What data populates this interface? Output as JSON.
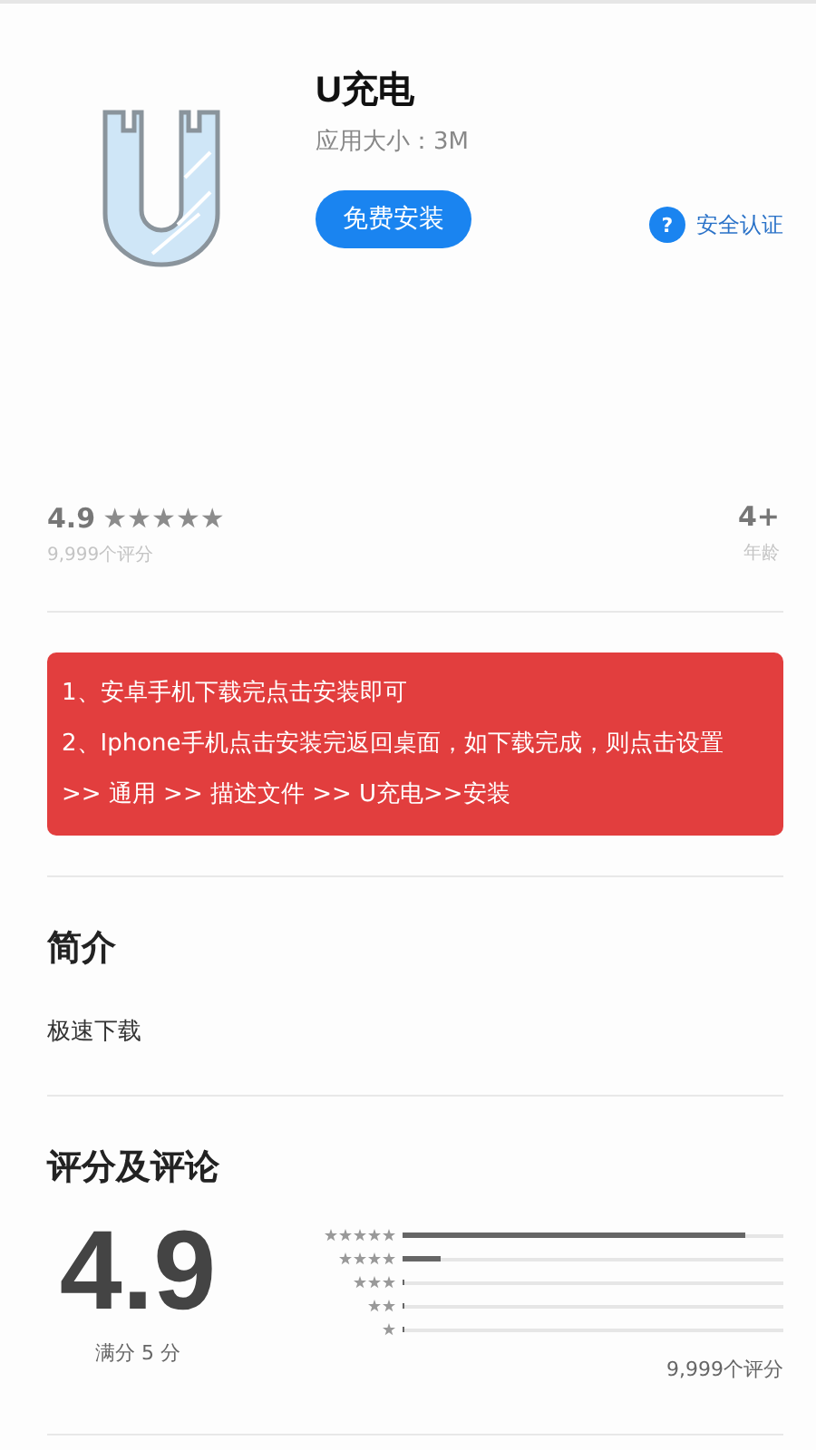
{
  "app": {
    "name": "U充电",
    "size": "应用大小：3M",
    "install_button": "免费安装",
    "security_label": "安全认证",
    "security_icon_text": "?"
  },
  "rating_summary": {
    "score": "4.9",
    "stars": 5,
    "count": "9,999个评分",
    "age": "4+",
    "age_label": "年龄"
  },
  "notice": {
    "lines": [
      "1、安卓手机下载完点击安装即可",
      "2、Iphone手机点击安装完返回桌面，如下载完成，则点击设置 >> 通用 >> 描述文件 >> U充电>>安装"
    ]
  },
  "intro": {
    "heading": "简介",
    "text": "极速下载"
  },
  "reviews": {
    "heading": "评分及评论",
    "score": "4.9",
    "out_of": "满分 5 分",
    "count": "9,999个评分",
    "histogram": [
      {
        "level": 0.9
      },
      {
        "level": 0.1
      },
      {
        "level": 0
      },
      {
        "level": 0
      },
      {
        "level": 0
      }
    ]
  }
}
